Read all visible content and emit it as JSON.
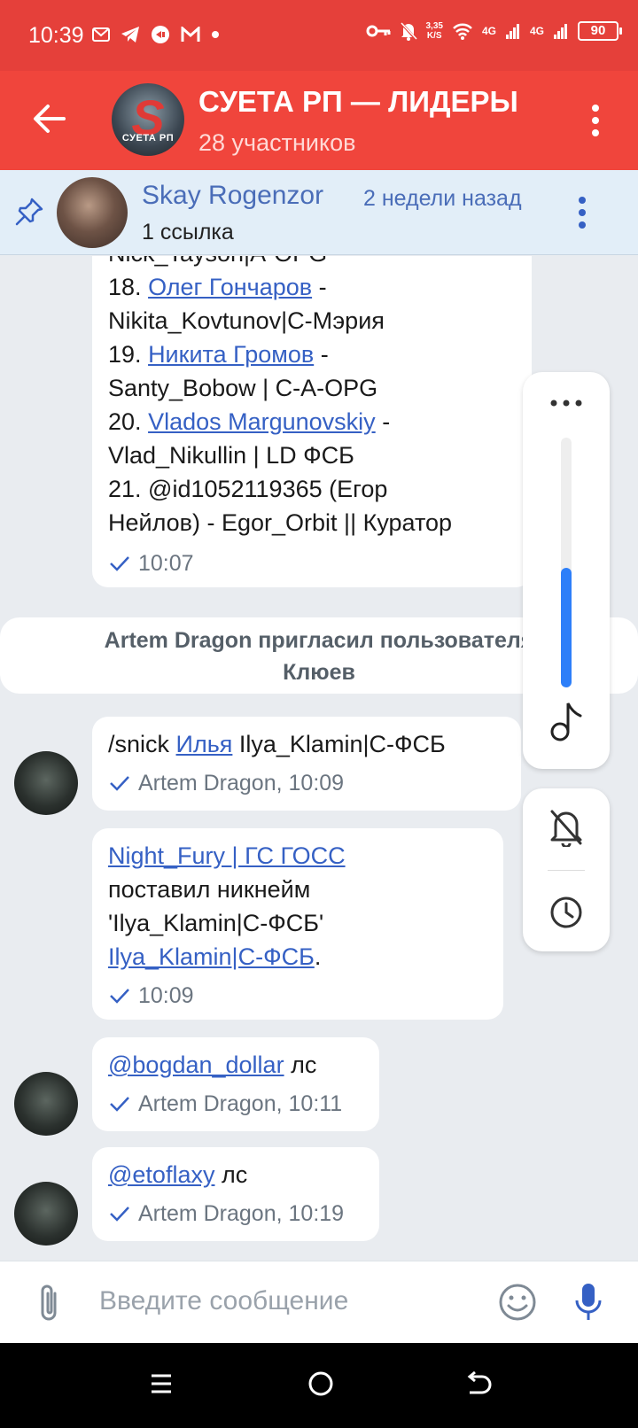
{
  "status_bar": {
    "time": "10:39",
    "speed_value": "3,35",
    "speed_unit": "K/S",
    "net1": "4G",
    "net2": "4G",
    "battery": "90"
  },
  "header": {
    "title": "СУЕТА РП — ЛИДЕРЫ",
    "subtitle": "28 участников",
    "avatar_text": "СУЕТА РП"
  },
  "pinned": {
    "name": "Skay Rogenzor",
    "time": "2 недели назад",
    "preview": "1 ссылка"
  },
  "messages": {
    "top_bubble": {
      "lines": {
        "l0": "Nick_Tayson|A-OPG",
        "l1_num": "18.",
        "l1_link": "Олег Гончаров",
        "l1_tail": " -",
        "l2": "Nikita_Kovtunov|C-Мэрия",
        "l3_num": "19.",
        "l3_link": "Никита Громов",
        "l3_tail": " -",
        "l4": "Santy_Bobow | C-A-OPG",
        "l5_num": "20.",
        "l5_link": "Vlados Margunovskiy",
        "l5_tail": " -",
        "l6": "Vlad_Nikullin | LD ФСБ",
        "l7": "21. @id1052119365 (Егор",
        "l8": "Нейлов) - Egor_Orbit || Куратор"
      },
      "time": "10:07"
    },
    "system_line1": "Artem Dragon пригласил пользователя",
    "system_line2": "Клюев",
    "snick": {
      "cmd": "/snick ",
      "link": "Илья",
      "tail": " Ilya_Klamin|C-ФСБ",
      "meta": "Artem Dragon, 10:09"
    },
    "nick_set": {
      "link1": "Night_Fury | ГС ГОСС",
      "line2": "поставил никнейм",
      "line3": "'Ilya_Klamin|C-ФСБ'",
      "link2": "Ilya_Klamin|C-ФСБ",
      "dot": ".",
      "time": "10:09"
    },
    "mention1": {
      "link": "@bogdan_dollar",
      "tail": " лс",
      "meta": "Artem Dragon, 10:11"
    },
    "mention2": {
      "link": "@etoflaxy",
      "tail": " лс",
      "meta": "Artem Dragon, 10:19"
    }
  },
  "volume_panel": {
    "level": 0.48
  },
  "input": {
    "placeholder": "Введите сообщение"
  },
  "colors": {
    "header": "#f0453c",
    "status": "#e5403a",
    "link": "#3560c4",
    "accent": "#2d7ff9"
  }
}
